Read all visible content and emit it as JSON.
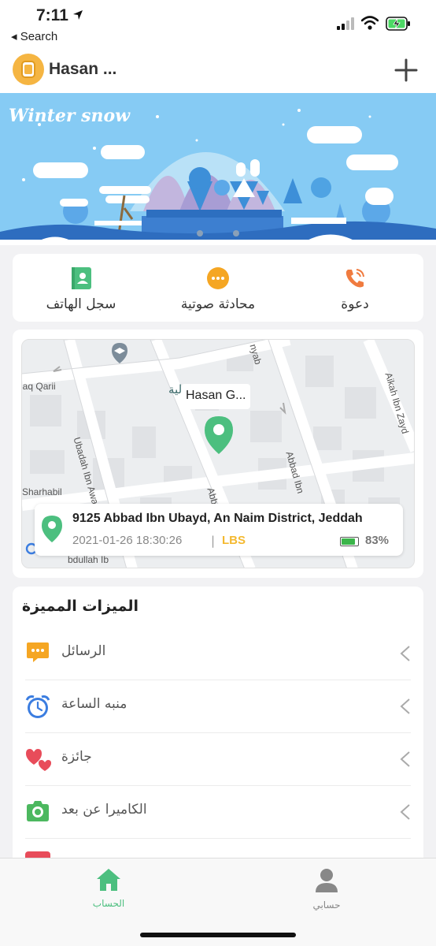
{
  "status_bar": {
    "time": "7:11",
    "back_label": "◂ Search"
  },
  "header": {
    "device_name": "Hasan ...",
    "add_icon": "plus-icon"
  },
  "banner": {
    "title": "Winter snow"
  },
  "actions": [
    {
      "label": "سجل الهاتف",
      "icon": "contacts-book-icon",
      "color": "#4cbf7f"
    },
    {
      "label": "محادثة صوتية",
      "icon": "voice-chat-icon",
      "color": "#f5a623"
    },
    {
      "label": "دعوة",
      "icon": "phone-call-icon",
      "color": "#f07b3f"
    }
  ],
  "map": {
    "labels": [
      "naq Qarii",
      "Ubadah Ibn Awanah",
      "Sharhabil",
      "Abbad Ibn",
      "Aikah Ibn Zayd",
      "nyab",
      "Abb",
      "bdullah Ib"
    ],
    "poi": "مهارات العالية",
    "device_tag": "Hasan G...",
    "address": "9125 Abbad Ibn Ubayd, An Naim District, Jeddah",
    "timestamp": "2021-01-26 18:30:26",
    "separator": "|",
    "source": "LBS",
    "battery_pct": "83%",
    "battery_level": 0.83
  },
  "features": {
    "title": "الميزات المميزة",
    "items": [
      {
        "label": "الرسائل",
        "icon": "message-icon",
        "color": "#f5a623"
      },
      {
        "label": "منبه الساعة",
        "icon": "alarm-clock-icon",
        "color": "#3b7de0"
      },
      {
        "label": "جائزة",
        "icon": "hearts-icon",
        "color": "#e84c5a"
      },
      {
        "label": "الكاميرا عن بعد",
        "icon": "camera-icon",
        "color": "#4cb85f"
      }
    ]
  },
  "tabs": [
    {
      "label": "الحساب",
      "icon": "home-icon",
      "active": true,
      "color": "#4cbf7f"
    },
    {
      "label": "حسابي",
      "icon": "person-icon",
      "active": false,
      "color": "#888888"
    }
  ]
}
